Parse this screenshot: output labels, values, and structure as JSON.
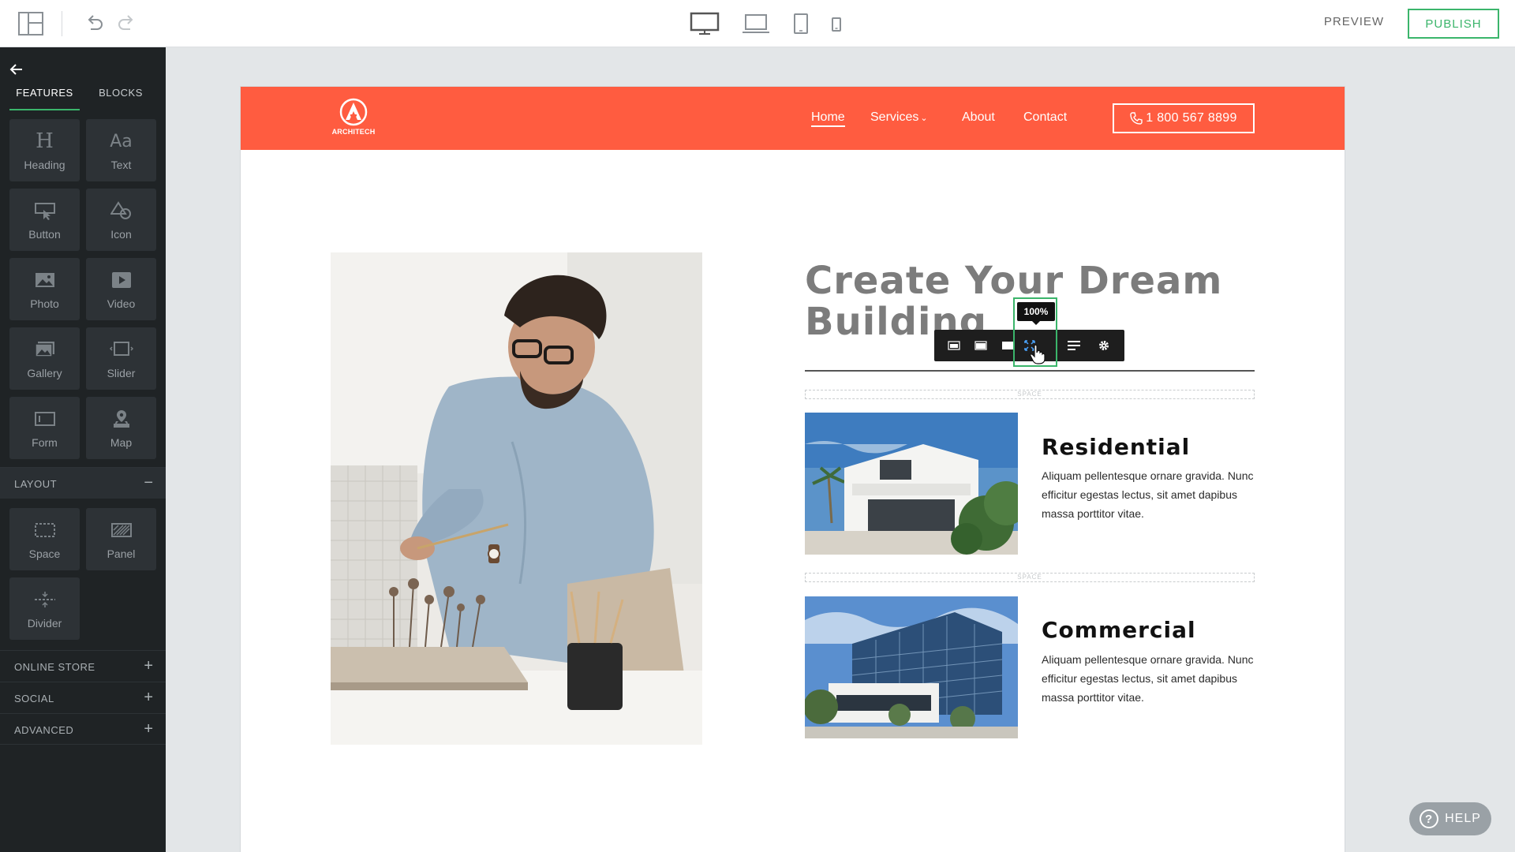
{
  "topbar": {
    "icons": [
      "layout-icon",
      "undo-icon",
      "redo-icon",
      "desktop-icon",
      "laptop-icon",
      "tablet-icon",
      "mobile-icon"
    ],
    "preview_label": "PREVIEW",
    "publish_label": "PUBLISH",
    "publish_color": "#3bb56b"
  },
  "sidebar": {
    "tabs": [
      {
        "label": "FEATURES",
        "active": true
      },
      {
        "label": "BLOCKS",
        "active": false
      }
    ],
    "features": [
      {
        "label": "Heading",
        "icon": "heading-icon",
        "glyph": "H"
      },
      {
        "label": "Text",
        "icon": "text-icon",
        "glyph": "Aa"
      },
      {
        "label": "Button",
        "icon": "button-icon"
      },
      {
        "label": "Icon",
        "icon": "shapes-icon"
      },
      {
        "label": "Photo",
        "icon": "photo-icon"
      },
      {
        "label": "Video",
        "icon": "video-icon"
      },
      {
        "label": "Gallery",
        "icon": "gallery-icon"
      },
      {
        "label": "Slider",
        "icon": "slider-icon"
      },
      {
        "label": "Form",
        "icon": "form-icon"
      },
      {
        "label": "Map",
        "icon": "map-icon"
      }
    ],
    "layout_section": {
      "label": "LAYOUT",
      "toggle": "−"
    },
    "layout_items": [
      {
        "label": "Space",
        "icon": "space-icon"
      },
      {
        "label": "Panel",
        "icon": "panel-icon"
      },
      {
        "label": "Divider",
        "icon": "divider-icon"
      }
    ],
    "sections": [
      {
        "label": "ONLINE STORE",
        "toggle": "+"
      },
      {
        "label": "SOCIAL",
        "toggle": "+"
      },
      {
        "label": "ADVANCED",
        "toggle": "+"
      }
    ]
  },
  "site": {
    "brand_color": "#ff5c40",
    "logo_text": "ARCHITECH",
    "nav": {
      "home": "Home",
      "services": "Services",
      "about": "About",
      "contact": "Contact"
    },
    "phone": "1 800 567 8899",
    "title": "Create Your Dream Building",
    "space_label": "SPACE",
    "features": [
      {
        "title": "Residential",
        "text": "Aliquam pellentesque ornare gravida. Nunc efficitur egestas lectus, sit amet dapibus massa porttitor vitae."
      },
      {
        "title": "Commercial",
        "text": "Aliquam pellentesque ornare gravida. Nunc efficitur egestas lectus, sit amet dapibus massa porttitor vitae."
      }
    ]
  },
  "image_toolbar": {
    "tooltip": "100%",
    "buttons": [
      "align-small-icon",
      "align-medium-icon",
      "align-large-icon",
      "fit-100-icon",
      "text-align-icon",
      "settings-gear-icon"
    ]
  },
  "help": {
    "label": "HELP"
  }
}
